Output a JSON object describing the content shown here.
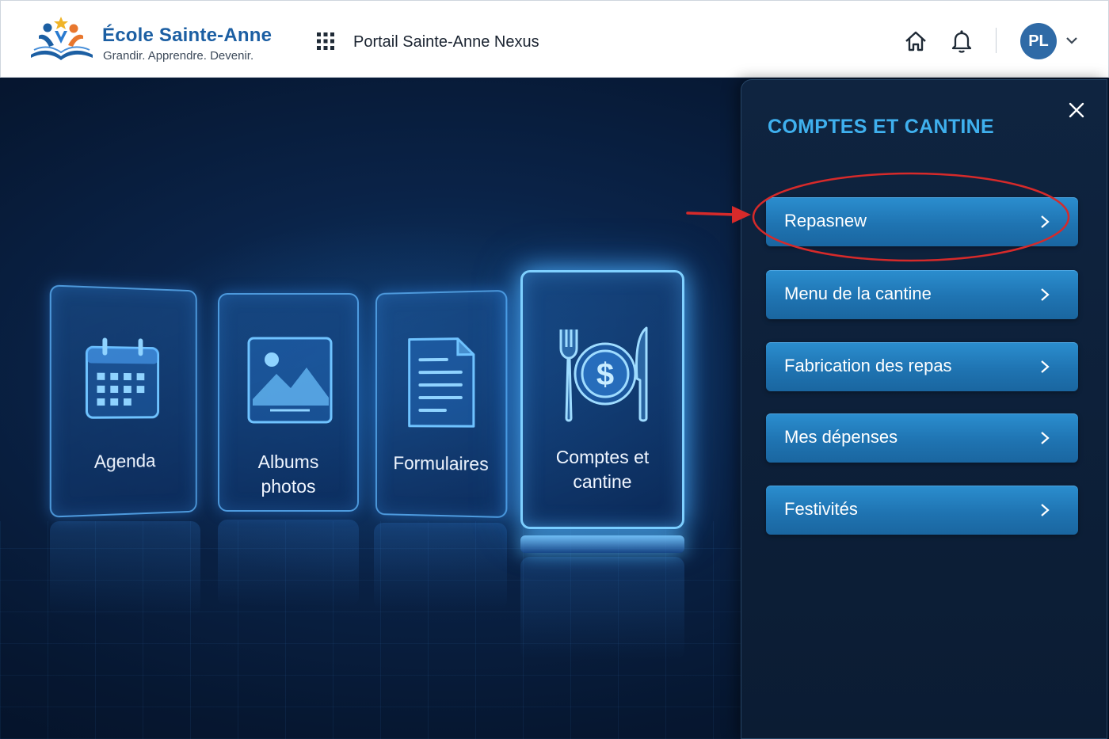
{
  "header": {
    "school_name": "École Sainte-Anne",
    "school_tagline": "Grandir. Apprendre. Devenir.",
    "portal_name": "Portail Sainte-Anne Nexus",
    "user_initials": "PL"
  },
  "tiles": [
    {
      "label": "Agenda",
      "icon": "calendar-icon"
    },
    {
      "label": "Albums\nphotos",
      "icon": "image-icon"
    },
    {
      "label": "Formulaires",
      "icon": "document-icon"
    },
    {
      "label": "Comptes et\ncantine",
      "icon": "cutlery-dollar-icon",
      "selected": true
    }
  ],
  "panel": {
    "title": "COMPTES ET CANTINE",
    "items": [
      {
        "label": "Repasnew",
        "highlighted": true
      },
      {
        "label": "Menu de la cantine"
      },
      {
        "label": "Fabrication des repas"
      },
      {
        "label": "Mes dépenses"
      },
      {
        "label": "Festivités"
      }
    ]
  },
  "colors": {
    "brand_blue": "#1c5fa3",
    "panel_title": "#3fb0ee",
    "button": "#2380c2",
    "annotation": "#d62a2a",
    "avatar": "#2f6aa6"
  }
}
